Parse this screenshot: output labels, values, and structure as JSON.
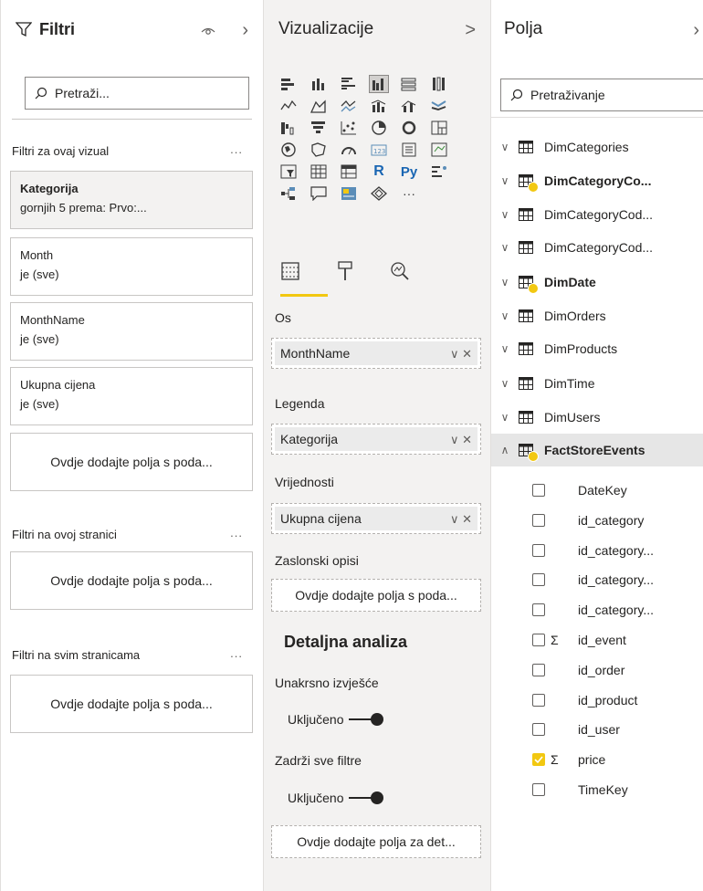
{
  "filters_pane": {
    "title": "Filtri",
    "search_placeholder": "Pretraži...",
    "visual_section": "Filtri za ovaj vizual",
    "page_section": "Filtri na ovoj stranici",
    "all_pages_section": "Filtri na svim stranicama",
    "more": "...",
    "cards": [
      {
        "name": "Kategorija",
        "value": "gornjih 5 prema: Prvo:..."
      },
      {
        "name": "Month",
        "value": "je (sve)"
      },
      {
        "name": "MonthName",
        "value": "je (sve)"
      },
      {
        "name": "Ukupna cijena",
        "value": "je (sve)"
      }
    ],
    "drop_hint": "Ovdje dodajte polja s poda..."
  },
  "viz_pane": {
    "title": "Vizualizacije",
    "chevron": ">",
    "axis_label": "Os",
    "axis_value": "MonthName",
    "legend_label": "Legenda",
    "legend_value": "Kategorija",
    "values_label": "Vrijednosti",
    "values_value": "Ukupna cijena",
    "tooltips_label": "Zaslonski opisi",
    "tooltips_hint": "Ovdje dodajte polja s poda...",
    "drillthrough_title": "Detaljna analiza",
    "cross_report_label": "Unakrsno izvješće",
    "toggle_on": "Uključeno",
    "keep_filters_label": "Zadrži sve filtre",
    "drill_hint": "Ovdje dodajte polja za det...",
    "well_controls": "∨ ✕",
    "more_visuals": "···"
  },
  "fields_pane": {
    "title": "Polja",
    "search_placeholder": "Pretraživanje",
    "tables": [
      {
        "name": "DimCategories",
        "bold": false,
        "badge": false
      },
      {
        "name": "DimCategoryCo...",
        "bold": true,
        "badge": true
      },
      {
        "name": "DimCategoryCod...",
        "bold": false,
        "badge": false
      },
      {
        "name": "DimCategoryCod...",
        "bold": false,
        "badge": false
      },
      {
        "name": "DimDate",
        "bold": true,
        "badge": true
      },
      {
        "name": "DimOrders",
        "bold": false,
        "badge": false
      },
      {
        "name": "DimProducts",
        "bold": false,
        "badge": false
      },
      {
        "name": "DimTime",
        "bold": false,
        "badge": false
      },
      {
        "name": "DimUsers",
        "bold": false,
        "badge": false
      },
      {
        "name": "FactStoreEvents",
        "bold": true,
        "badge": true,
        "expanded": true
      }
    ],
    "fields": [
      {
        "name": "DateKey",
        "sigma": false,
        "checked": false
      },
      {
        "name": "id_category",
        "sigma": false,
        "checked": false
      },
      {
        "name": "id_category...",
        "sigma": false,
        "checked": false
      },
      {
        "name": "id_category...",
        "sigma": false,
        "checked": false
      },
      {
        "name": "id_category...",
        "sigma": false,
        "checked": false
      },
      {
        "name": "id_event",
        "sigma": true,
        "checked": false
      },
      {
        "name": "id_order",
        "sigma": false,
        "checked": false
      },
      {
        "name": "id_product",
        "sigma": false,
        "checked": false
      },
      {
        "name": "id_user",
        "sigma": false,
        "checked": false
      },
      {
        "name": "price",
        "sigma": true,
        "checked": true
      },
      {
        "name": "TimeKey",
        "sigma": false,
        "checked": false
      }
    ],
    "sigma_symbol": "Σ"
  }
}
